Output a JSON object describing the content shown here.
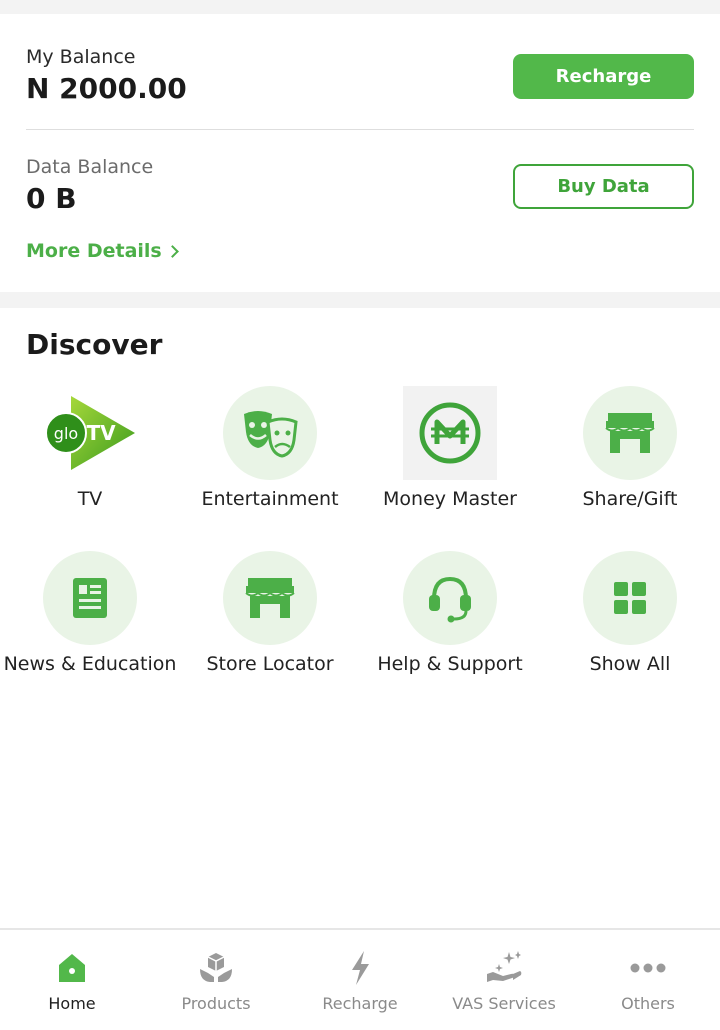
{
  "balance": {
    "my_balance_label": "My Balance",
    "my_balance_value": "N 2000.00",
    "recharge_label": "Recharge",
    "data_balance_label": "Data Balance",
    "data_balance_value": "0 B",
    "buy_data_label": "Buy Data",
    "more_details_label": "More Details"
  },
  "discover": {
    "title": "Discover",
    "items": [
      {
        "label": "TV",
        "icon": "glo-tv-logo"
      },
      {
        "label": "Entertainment",
        "icon": "theater-masks-icon"
      },
      {
        "label": "Money Master",
        "icon": "money-master-icon"
      },
      {
        "label": "Share/Gift",
        "icon": "storefront-icon"
      },
      {
        "label": "News & Education",
        "icon": "news-icon"
      },
      {
        "label": "Store Locator",
        "icon": "store-icon"
      },
      {
        "label": "Help & Support",
        "icon": "headset-icon"
      },
      {
        "label": "Show All",
        "icon": "grid-icon"
      }
    ],
    "tv_logo_text_glo": "glo",
    "tv_logo_text_tv": "TV"
  },
  "bottom_nav": {
    "items": [
      {
        "label": "Home",
        "icon": "home-icon",
        "active": true
      },
      {
        "label": "Products",
        "icon": "products-icon",
        "active": false
      },
      {
        "label": "Recharge",
        "icon": "lightning-icon",
        "active": false
      },
      {
        "label": "VAS Services",
        "icon": "hand-sparkle-icon",
        "active": false
      },
      {
        "label": "Others",
        "icon": "more-dots-icon",
        "active": false
      }
    ]
  },
  "colors": {
    "brand_green": "#52b84a",
    "light_green_bg": "#e9f4e6",
    "text_dark": "#1b1b1b",
    "nav_inactive": "#8a8a8a"
  }
}
